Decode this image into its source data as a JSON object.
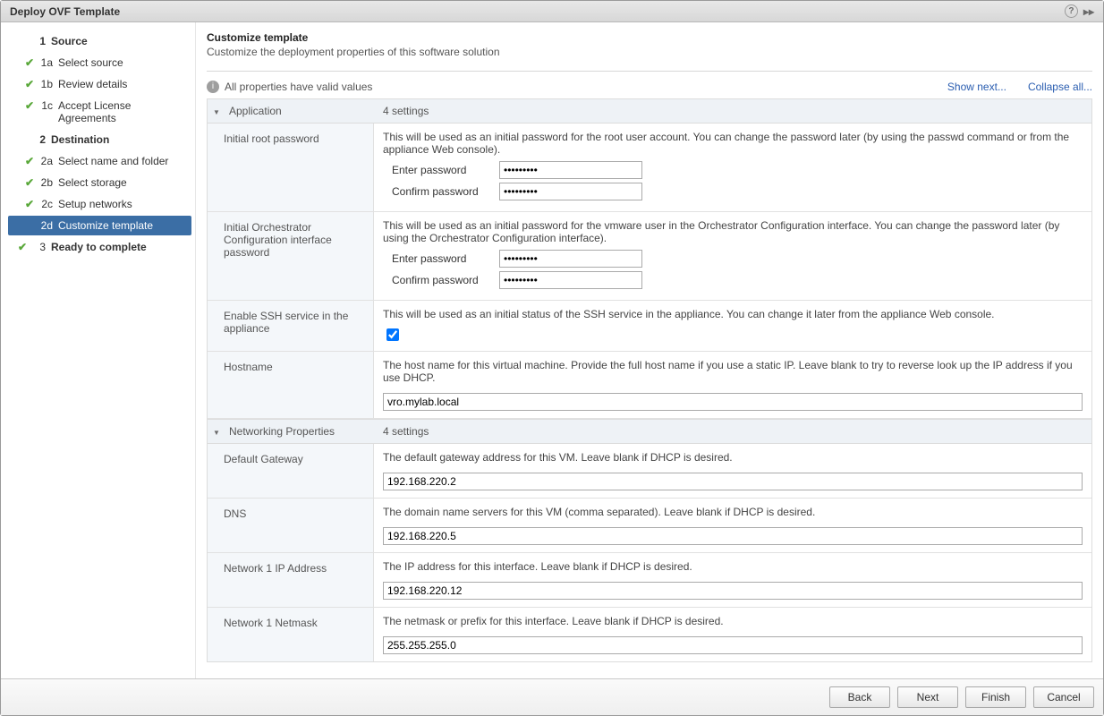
{
  "window": {
    "title": "Deploy OVF Template"
  },
  "sidebar": {
    "sections": [
      {
        "num": "1",
        "label": "Source"
      },
      {
        "num": "2",
        "label": "Destination"
      },
      {
        "num": "3",
        "label": "Ready to complete"
      }
    ],
    "steps": {
      "s1a": "Select source",
      "s1b": "Review details",
      "s1c": "Accept License Agreements",
      "s2a": "Select name and folder",
      "s2b": "Select storage",
      "s2c": "Setup networks",
      "s2d": "Customize template"
    },
    "nums": {
      "s1a": "1a",
      "s1b": "1b",
      "s1c": "1c",
      "s2a": "2a",
      "s2b": "2b",
      "s2c": "2c",
      "s2d": "2d"
    }
  },
  "page": {
    "title": "Customize template",
    "subtitle": "Customize the deployment properties of this software solution"
  },
  "status": {
    "text": "All properties have valid values",
    "show_next": "Show next...",
    "collapse_all": "Collapse all..."
  },
  "groups": {
    "application": {
      "name": "Application",
      "meta": "4 settings"
    },
    "networking": {
      "name": "Networking Properties",
      "meta": "4 settings"
    }
  },
  "props": {
    "root_pw": {
      "label": "Initial root password",
      "desc": "This will be used as an initial password for the root user account. You can change the password later (by using the passwd command or from the appliance Web console).",
      "enter_label": "Enter password",
      "confirm_label": "Confirm password",
      "enter_value": "*********",
      "confirm_value": "*********"
    },
    "orch_pw": {
      "label": "Initial Orchestrator Configuration interface password",
      "desc": "This will be used as an initial password for the vmware user in the Orchestrator Configuration interface. You can change the password later (by using the Orchestrator Configuration interface).",
      "enter_label": "Enter password",
      "confirm_label": "Confirm password",
      "enter_value": "*********",
      "confirm_value": "*********"
    },
    "ssh": {
      "label": "Enable SSH service in the appliance",
      "desc": "This will be used as an initial status of the SSH service in the appliance. You can change it later from the appliance Web console."
    },
    "hostname": {
      "label": "Hostname",
      "desc": "The host name for this virtual machine. Provide the full host name if you use a static IP. Leave blank to try to reverse look up the IP address if you use DHCP.",
      "value": "vro.mylab.local"
    },
    "gateway": {
      "label": "Default Gateway",
      "desc": "The default gateway address for this VM. Leave blank if DHCP is desired.",
      "value": "192.168.220.2"
    },
    "dns": {
      "label": "DNS",
      "desc": "The domain name servers for this VM (comma separated). Leave blank if DHCP is desired.",
      "value": "192.168.220.5"
    },
    "ip": {
      "label": "Network 1 IP Address",
      "desc": "The IP address for this interface. Leave blank if DHCP is desired.",
      "value": "192.168.220.12"
    },
    "netmask": {
      "label": "Network 1 Netmask",
      "desc": "The netmask or prefix for this interface. Leave blank if DHCP is desired.",
      "value": "255.255.255.0"
    }
  },
  "footer": {
    "back": "Back",
    "next": "Next",
    "finish": "Finish",
    "cancel": "Cancel"
  }
}
